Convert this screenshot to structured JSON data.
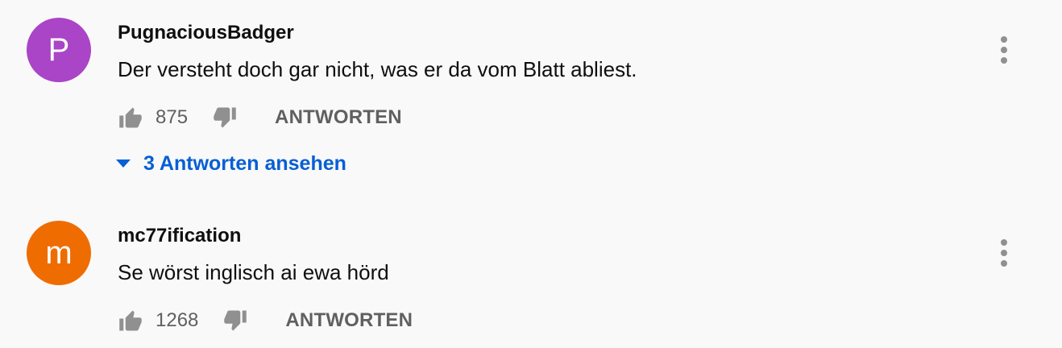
{
  "comments": [
    {
      "avatar_letter": "P",
      "avatar_color": "#a945c6",
      "author": "PugnaciousBadger",
      "text": "Der versteht doch gar nicht, was er da vom Blatt abliest.",
      "likes": "875",
      "reply_label": "ANTWORTEN",
      "view_replies_label": "3 Antworten ansehen"
    },
    {
      "avatar_letter": "m",
      "avatar_color": "#ef6c00",
      "author": "mc77ification",
      "text": "Se wörst inglisch ai ewa hörd",
      "likes": "1268",
      "reply_label": "ANTWORTEN"
    }
  ],
  "colors": {
    "background": "#f9f9f9",
    "text_primary": "#0f0f0f",
    "text_secondary": "#606060",
    "link_blue": "#065fd4"
  },
  "icons": {
    "like": "thumbs-up-icon",
    "dislike": "thumbs-down-icon",
    "menu": "vertical-dots-icon",
    "expand": "caret-down-icon"
  }
}
